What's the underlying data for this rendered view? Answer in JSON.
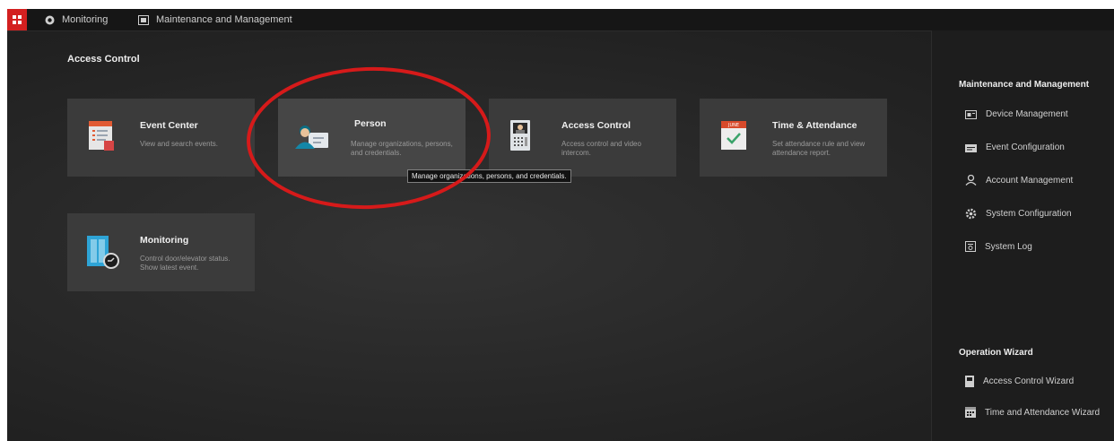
{
  "nav": {
    "monitoring": "Monitoring",
    "maintenance": "Maintenance and Management"
  },
  "main": {
    "section_title": "Access Control",
    "cards": [
      {
        "title": "Event Center",
        "desc": "View and search events."
      },
      {
        "title": "Person",
        "desc": "Manage organizations, persons, and credentials."
      },
      {
        "title": "Access Control",
        "desc": "Access control and video intercom."
      },
      {
        "title": "Time & Attendance",
        "desc": "Set attendance rule and view attendance report.",
        "calendar_label": "JUNE"
      },
      {
        "title": "Monitoring",
        "desc": "Control door/elevator status. Show latest event."
      }
    ],
    "tooltip": "Manage organizations, persons, and credentials."
  },
  "right_panel": {
    "maint_title": "Maintenance and Management",
    "maint_items": [
      "Device Management",
      "Event Configuration",
      "Account Management",
      "System Configuration",
      "System Log"
    ],
    "wizard_title": "Operation Wizard",
    "wizard_items": [
      "Access Control Wizard",
      "Time and Attendance Wizard"
    ]
  },
  "colors": {
    "accent": "#d32020",
    "annotation": "#d61a1a",
    "card_bg": "#3b3b3b"
  }
}
